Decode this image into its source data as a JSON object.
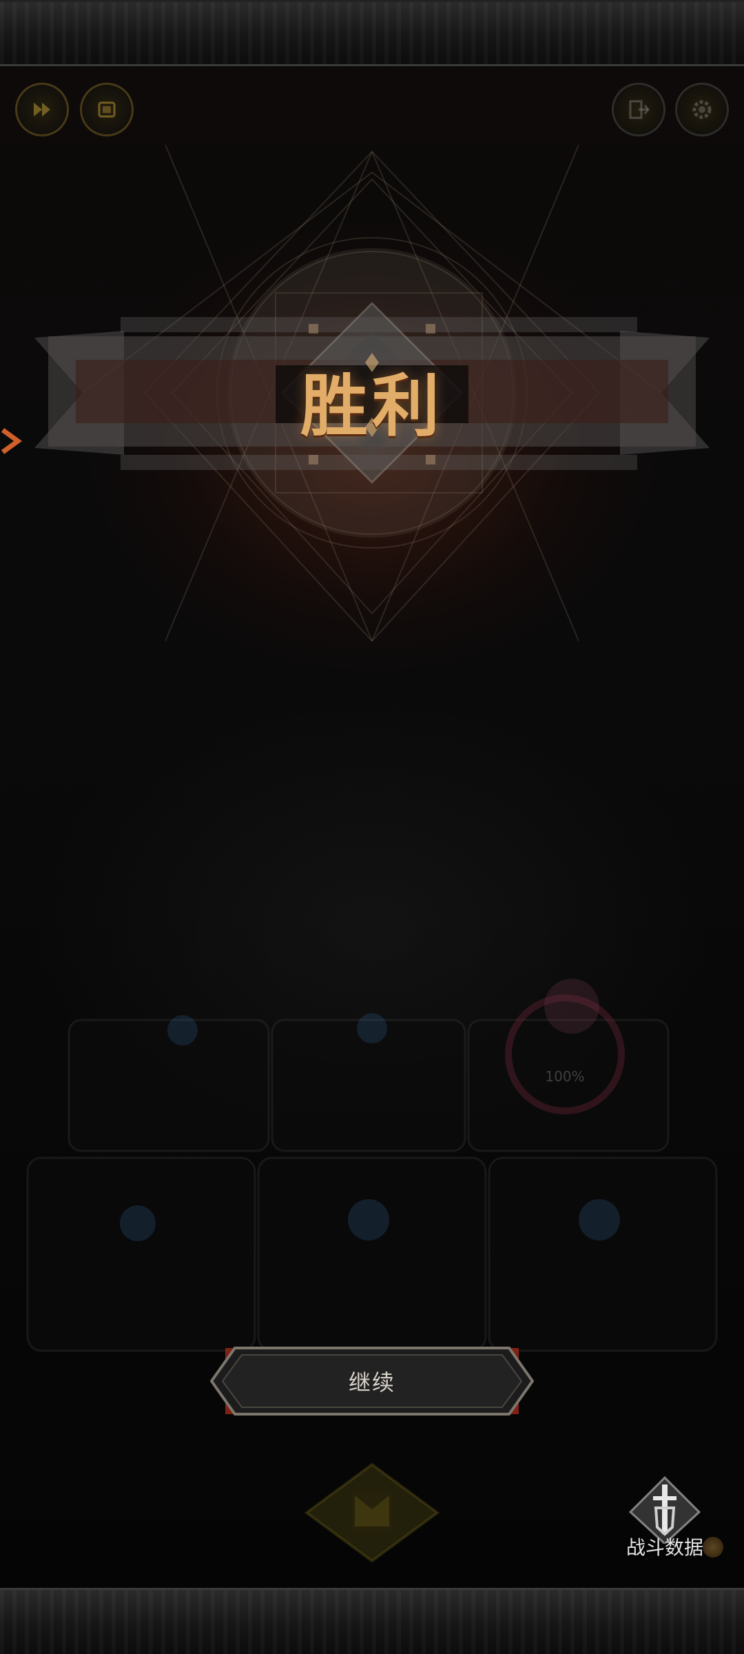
{
  "title": "胜利",
  "continue_label": "继续",
  "stats_label": "战斗数据",
  "unit_hp_percent": "100%",
  "top_left_icons": [
    "fast-forward-icon",
    "auto-battle-icon"
  ],
  "top_right_icons": [
    "exit-icon",
    "settings-icon"
  ],
  "colors": {
    "title_gold": "#e2ad68",
    "button_text": "#d7d3ca",
    "background": "#0a0a0a"
  }
}
